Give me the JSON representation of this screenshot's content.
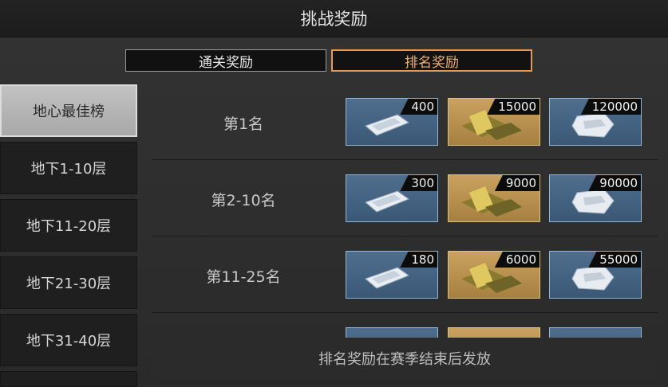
{
  "header": {
    "title": "挑战奖励"
  },
  "tabs": [
    {
      "label": "通关奖励",
      "active": false
    },
    {
      "label": "排名奖励",
      "active": true
    }
  ],
  "sidebar": {
    "items": [
      {
        "label": "地心最佳榜",
        "selected": true
      },
      {
        "label": "地下1-10层",
        "selected": false
      },
      {
        "label": "地下11-20层",
        "selected": false
      },
      {
        "label": "地下21-30层",
        "selected": false
      },
      {
        "label": "地下31-40层",
        "selected": false
      }
    ]
  },
  "rewards": [
    {
      "rank": "第1名",
      "items": [
        {
          "icon": "silver-ticket-icon",
          "qty": "400"
        },
        {
          "icon": "gold-bars-icon",
          "qty": "15000"
        },
        {
          "icon": "silver-crystal-icon",
          "qty": "120000"
        }
      ]
    },
    {
      "rank": "第2-10名",
      "items": [
        {
          "icon": "silver-ticket-icon",
          "qty": "300"
        },
        {
          "icon": "gold-bars-icon",
          "qty": "9000"
        },
        {
          "icon": "silver-crystal-icon",
          "qty": "90000"
        }
      ]
    },
    {
      "rank": "第11-25名",
      "items": [
        {
          "icon": "silver-ticket-icon",
          "qty": "180"
        },
        {
          "icon": "gold-bars-icon",
          "qty": "6000"
        },
        {
          "icon": "silver-crystal-icon",
          "qty": "55000"
        }
      ]
    }
  ],
  "footer": {
    "note": "排名奖励在赛季结束后发放"
  },
  "colors": {
    "accent": "#e79a4f",
    "item_blue": "#4a6a8a",
    "item_gold": "#c09a58"
  }
}
